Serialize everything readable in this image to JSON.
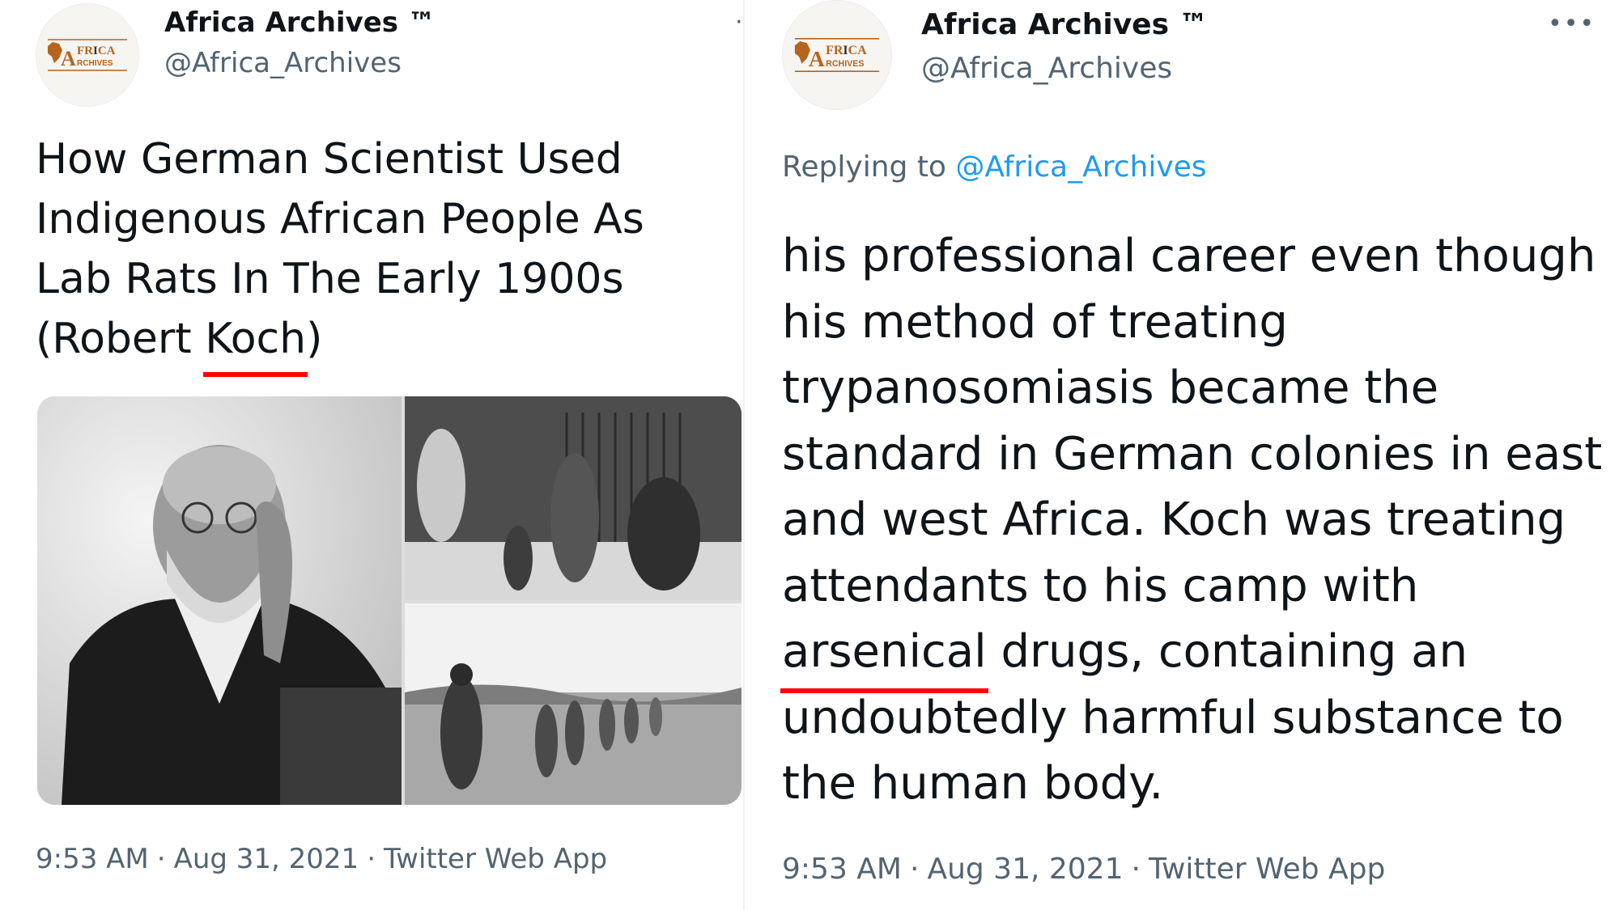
{
  "left_tweet": {
    "display_name": "Africa Archives ™",
    "handle": "@Africa_Archives",
    "text_before": "How German Scientist Used Indigenous African People As Lab Rats In The Early 1900s (Robert ",
    "text_marked": "Koch",
    "text_after": ")",
    "time": "9:53 AM",
    "date": "Aug 31, 2021",
    "source": "Twitter Web App",
    "separator": "·"
  },
  "right_tweet": {
    "display_name": "Africa Archives ™",
    "handle": "@Africa_Archives",
    "replying_prefix": "Replying to ",
    "replying_handle": "@Africa_Archives",
    "text_before": "his professional career even though his method of treating trypanosomiasis became the standard in German colonies in east and west Africa. Koch was treating attendants to his camp with ",
    "text_marked": "arsenical",
    "text_after": " drugs, containing an undoubtedly harmful substance to the human body.",
    "time": "9:53 AM",
    "date": "Aug 31, 2021",
    "source": "Twitter Web App",
    "separator": "·"
  },
  "logo": {
    "top_text": "FRICA",
    "bottom_text": "RCHIVES",
    "letter": "A"
  },
  "icons": {
    "more": "more-options-icon",
    "dot": "dot-icon"
  },
  "colors": {
    "text": "#0f1419",
    "secondary": "#536471",
    "link": "#1d9bf0",
    "highlight": "#ff0000",
    "logo_brown": "#b5651d"
  }
}
